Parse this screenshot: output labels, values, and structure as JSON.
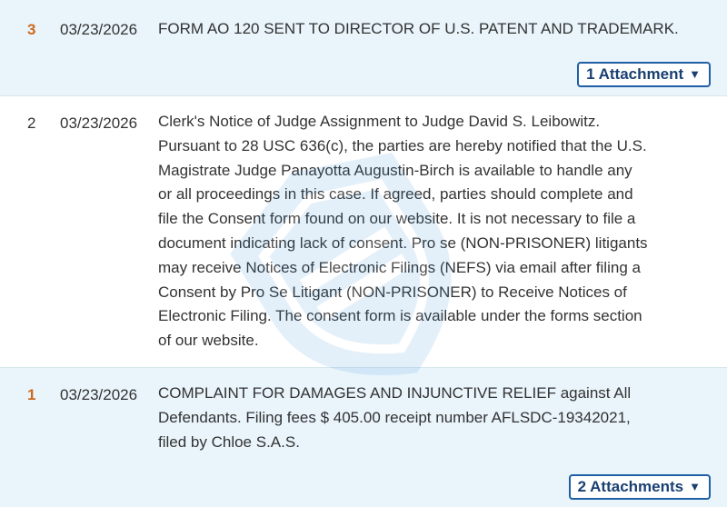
{
  "entries": [
    {
      "number": "3",
      "date": "03/23/2026",
      "lines": [
        "FORM AO 120 SENT TO DIRECTOR OF U.S. PATENT AND TRADEMARK."
      ],
      "attachments_label": "1 Attachment"
    },
    {
      "number": "2",
      "date": "03/23/2026",
      "lines": [
        "Clerk's Notice of Judge Assignment to Judge David S. Leibowitz.",
        "Pursuant to 28 USC 636(c), the parties are hereby notified that the U.S.",
        "Magistrate Judge Panayotta Augustin-Birch is available to handle any",
        "or all proceedings in this case. If agreed, parties should complete and",
        "file the Consent form found on our website. It is not necessary to file a",
        "document indicating lack of consent. Pro se (NON-PRISONER) litigants",
        "may receive Notices of Electronic Filings (NEFS) via email after filing a",
        "Consent by Pro Se Litigant (NON-PRISONER) to Receive Notices of",
        "Electronic Filing. The consent form is available under the forms section",
        "of our website."
      ]
    },
    {
      "number": "1",
      "date": "03/23/2026",
      "lines": [
        "COMPLAINT FOR DAMAGES AND INJUNCTIVE RELIEF against All",
        "Defendants. Filing fees $ 405.00 receipt number AFLSDC-19342021,",
        "filed by Chloe S.A.S."
      ],
      "attachments_label": "2 Attachments"
    }
  ],
  "icons": {
    "dropdown": "caret-down-icon",
    "watermark": "shield-watermark-icon"
  },
  "colors": {
    "highlight_bg": "#e9f4fb",
    "number_accent": "#cc6a1f",
    "button_border": "#1f5fa6",
    "button_text": "#1a3f72"
  }
}
